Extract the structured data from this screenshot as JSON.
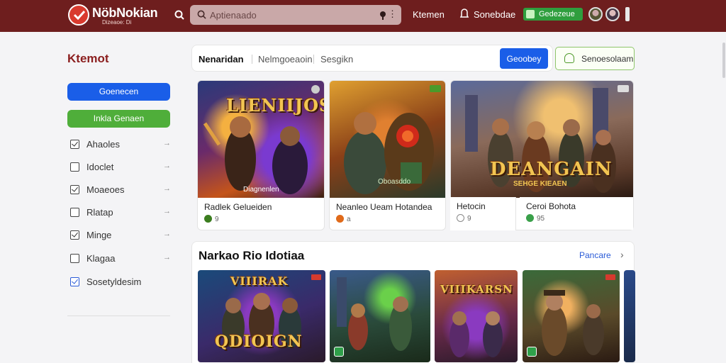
{
  "header": {
    "logo_text": "NöbNokian",
    "logo_sub": "Dizeaoe: Di",
    "search_placeholder": "Aptienaado",
    "nav_1": "Ktemen",
    "nav_2": "Sonebdae",
    "green_pill": "Gedezeue"
  },
  "sidebar": {
    "title": "Ktemot",
    "button_blue": "Goenecen",
    "button_green": "Inkla Genaen",
    "items": [
      {
        "label": "Ahaoles",
        "checked": true
      },
      {
        "label": "Idoclet",
        "checked": false
      },
      {
        "label": "Moaeoes",
        "checked": true
      },
      {
        "label": "Rlataр",
        "checked": false
      },
      {
        "label": "Minge",
        "checked": true
      },
      {
        "label": "Klagaa",
        "checked": false
      },
      {
        "label": "Sosetyldesim",
        "checked": true
      }
    ],
    "arrow": "→"
  },
  "tabs": {
    "active": "Nenaridan",
    "tab_2": "Nelmgoeaoin",
    "tab_3": "Sesgikn",
    "blue_button": "Geoobey",
    "green_button": "Senoesolaam"
  },
  "featured": [
    {
      "title": "Radlek Gelueiden",
      "meta": "9",
      "art_text": "LIENIIJOSA",
      "caption": "Diagnenlen",
      "icon_color": "#3b7d1f"
    },
    {
      "title": "Neanleo Ueam Hotandea",
      "meta": "a",
      "art_text": "",
      "caption": "Oboasddo",
      "icon_color": "#e06a1a"
    },
    {
      "title": "Hetocin",
      "meta": "9",
      "art_text": "",
      "caption": "",
      "icon_color": "#888888"
    },
    {
      "title": "Ceroi Bohota",
      "meta": "95",
      "art_text": "DEANGAIN",
      "caption": "SEHGE KIEAEN",
      "icon_color": "#3aa04a"
    }
  ],
  "section": {
    "title": "Narkao Rio Idotiaa",
    "link": "Pancare",
    "chevron": "›",
    "tiles": [
      {
        "art_text": "QDIOIGN",
        "top_text": "VIIIRAK"
      },
      {
        "art_text": "",
        "top_text": ""
      },
      {
        "art_text": "",
        "top_text": "VIIIKARSN"
      },
      {
        "art_text": "",
        "top_text": ""
      }
    ]
  },
  "colors": {
    "header_bg": "#6e1e1e",
    "accent_blue": "#1a5ee8",
    "accent_green": "#4fae3a",
    "title_red": "#8b1e1e"
  }
}
